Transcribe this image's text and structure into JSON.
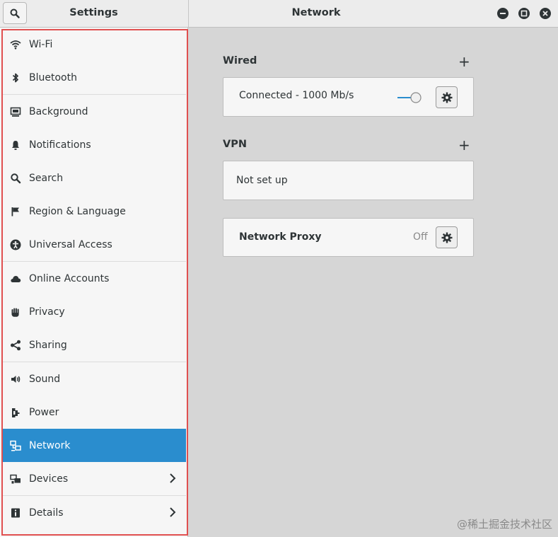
{
  "header": {
    "left_title": "Settings",
    "right_title": "Network",
    "search_icon": "search-icon",
    "window_buttons": [
      "minimize-icon",
      "maximize-icon",
      "close-icon"
    ]
  },
  "sidebar": {
    "items": [
      {
        "label": "Wi-Fi",
        "icon": "wifi-icon"
      },
      {
        "label": "Bluetooth",
        "icon": "bluetooth-icon"
      },
      {
        "label": "Background",
        "icon": "background-icon"
      },
      {
        "label": "Notifications",
        "icon": "bell-icon"
      },
      {
        "label": "Search",
        "icon": "search-icon"
      },
      {
        "label": "Region & Language",
        "icon": "flag-icon"
      },
      {
        "label": "Universal Access",
        "icon": "accessibility-icon"
      },
      {
        "label": "Online Accounts",
        "icon": "cloud-icon"
      },
      {
        "label": "Privacy",
        "icon": "hand-icon"
      },
      {
        "label": "Sharing",
        "icon": "share-icon"
      },
      {
        "label": "Sound",
        "icon": "speaker-icon"
      },
      {
        "label": "Power",
        "icon": "power-plug-icon"
      },
      {
        "label": "Network",
        "icon": "network-icon",
        "active": true
      },
      {
        "label": "Devices",
        "icon": "devices-icon",
        "chevron": true
      },
      {
        "label": "Details",
        "icon": "info-icon",
        "chevron": true
      }
    ]
  },
  "main": {
    "wired": {
      "title": "Wired",
      "add": "+",
      "status": "Connected - 1000 Mb/s",
      "toggle_on": true
    },
    "vpn": {
      "title": "VPN",
      "add": "+",
      "status": "Not set up"
    },
    "proxy": {
      "label": "Network Proxy",
      "value": "Off"
    }
  },
  "watermark": "@稀土掘金技术社区",
  "colors": {
    "accent": "#2a8dce",
    "highlight_border": "#e05050"
  }
}
